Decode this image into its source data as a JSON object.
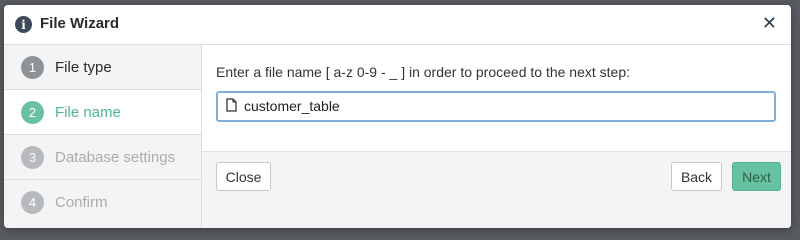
{
  "dialog": {
    "title": "File Wizard",
    "info_icon": "info-circle-icon",
    "close_icon": "close-icon",
    "close_glyph": "✕"
  },
  "steps": [
    {
      "number": "1",
      "label": "File type",
      "state": "done"
    },
    {
      "number": "2",
      "label": "File name",
      "state": "current"
    },
    {
      "number": "3",
      "label": "Database settings",
      "state": "pending"
    },
    {
      "number": "4",
      "label": "Confirm",
      "state": "pending"
    }
  ],
  "content": {
    "prompt": "Enter a file name [ a-z 0-9 - _ ] in order to proceed to the next step:",
    "file_name_value": "customer_table",
    "file_icon": "document-icon"
  },
  "footer": {
    "close_label": "Close",
    "back_label": "Back",
    "next_label": "Next"
  },
  "colors": {
    "accent": "#66c2a0",
    "accent_text": "#4ab893",
    "input_border": "#7faed8"
  }
}
